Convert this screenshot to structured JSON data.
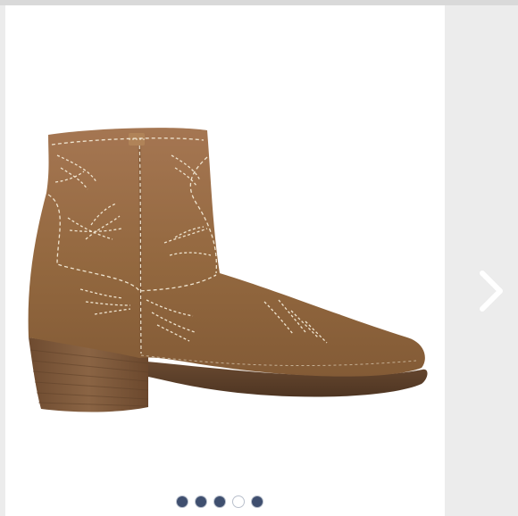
{
  "carousel": {
    "image_alt": "",
    "next_icon": "chevron-right-icon",
    "slide_count": 5,
    "active_index": 3,
    "colors": {
      "dot_inactive": "#3f4f6f",
      "dot_active": "#ffffff",
      "arrow": "#ffffff",
      "background": "#ececec"
    }
  },
  "product": {
    "boot_color": "#9a6e4a",
    "stitch_color": "#efe4cf",
    "heel_color": "#7d5a3f"
  }
}
